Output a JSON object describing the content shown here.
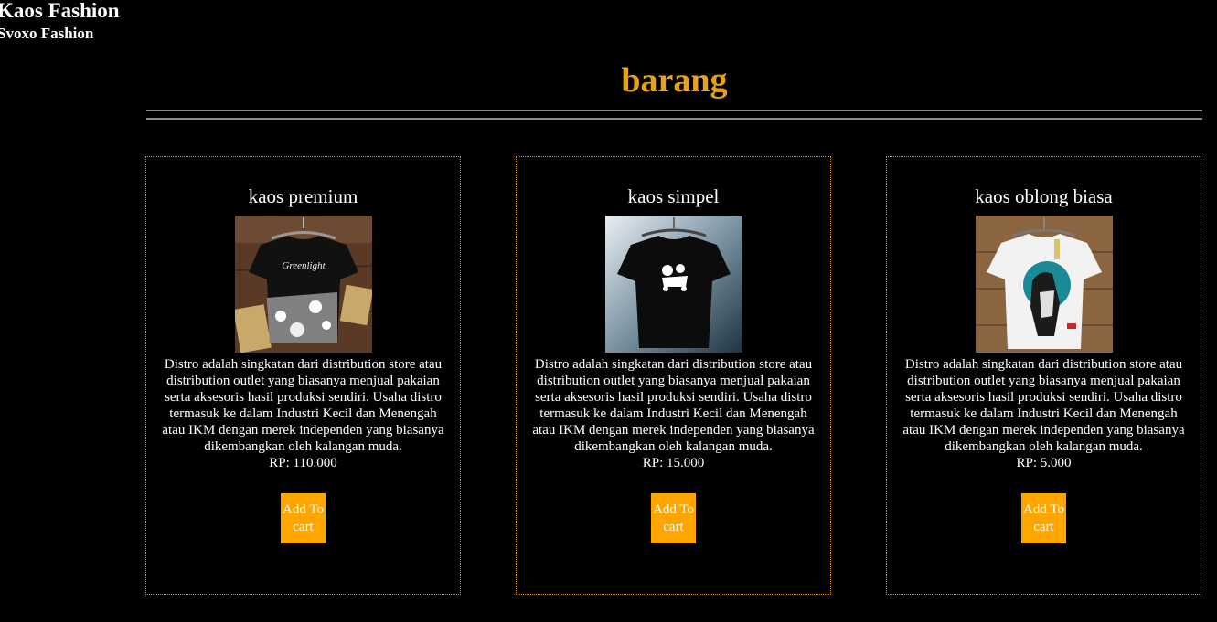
{
  "site": {
    "title": "Kaos Fashion",
    "subtitle": "Svoxo Fashion"
  },
  "page": {
    "heading": "barang"
  },
  "colors": {
    "accent": "#e6a21e",
    "button": "#ffa500",
    "border": "#d4902a",
    "background": "#000000"
  },
  "products": [
    {
      "name": "kaos premium",
      "image": "black-tshirt-splatter-print",
      "description": "Distro adalah singkatan dari distribution store atau distribution outlet yang biasanya menjual pakaian serta aksesoris hasil produksi sendiri. Usaha distro termasuk ke dalam Industri Kecil dan Menengah atau IKM dengan merek independen yang biasanya dikembangkan oleh kalangan muda.",
      "price": "RP: 110.000",
      "button": "Add To cart"
    },
    {
      "name": "kaos simpel",
      "image": "black-tshirt-scooter-print",
      "description": "Distro adalah singkatan dari distribution store atau distribution outlet yang biasanya menjual pakaian serta aksesoris hasil produksi sendiri. Usaha distro termasuk ke dalam Industri Kecil dan Menengah atau IKM dengan merek independen yang biasanya dikembangkan oleh kalangan muda.",
      "price": "RP: 15.000",
      "button": "Add To cart"
    },
    {
      "name": "kaos oblong biasa",
      "image": "white-tshirt-teal-graphic",
      "description": "Distro adalah singkatan dari distribution store atau distribution outlet yang biasanya menjual pakaian serta aksesoris hasil produksi sendiri. Usaha distro termasuk ke dalam Industri Kecil dan Menengah atau IKM dengan merek independen yang biasanya dikembangkan oleh kalangan muda.",
      "price": "RP: 5.000",
      "button": "Add To cart"
    }
  ]
}
